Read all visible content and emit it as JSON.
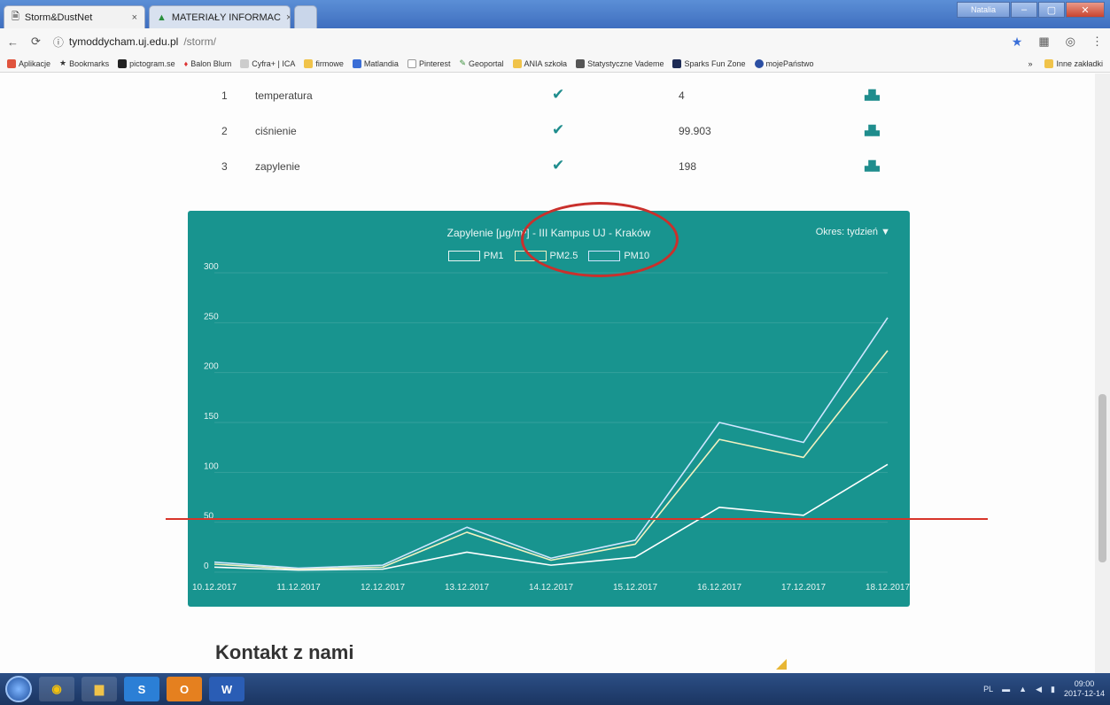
{
  "browser": {
    "tabs": [
      {
        "label": "Storm&DustNet",
        "active": true
      },
      {
        "label": "MATERIAŁY INFORMAC",
        "active": false
      }
    ],
    "window_text": "Natalia",
    "url_host": "tymoddycham.uj.edu.pl",
    "url_path": "/storm/",
    "bookmarks": [
      "Aplikacje",
      "Bookmarks",
      "pictogram.se",
      "Balon Blum",
      "Cyfra+ | ICA",
      "firmowe",
      "Matlandia",
      "Pinterest",
      "Geoportal",
      "ANIA szkoła",
      "Statystyczne Vademe",
      "Sparks Fun Zone",
      "mojePaństwo"
    ],
    "bookmarks_more": "»",
    "other_bookmarks": "Inne zakładki"
  },
  "sensors": [
    {
      "num": "1",
      "name": "temperatura",
      "value": "4"
    },
    {
      "num": "2",
      "name": "ciśnienie",
      "value": "99.903"
    },
    {
      "num": "3",
      "name": "zapylenie",
      "value": "198"
    }
  ],
  "chart": {
    "title": "Zapylenie [μg/m³] - III Kampus UJ - Kraków",
    "period": "Okres: tydzień"
  },
  "chart_data": {
    "type": "line",
    "title": "Zapylenie [μg/m³] - III Kampus UJ - Kraków",
    "xlabel": "",
    "ylabel": "",
    "categories": [
      "10.12.2017",
      "11.12.2017",
      "12.12.2017",
      "13.12.2017",
      "14.12.2017",
      "15.12.2017",
      "16.12.2017",
      "17.12.2017",
      "18.12.2017"
    ],
    "series": [
      {
        "name": "PM1",
        "color": "#ffffff",
        "values": [
          5,
          2,
          3,
          20,
          7,
          15,
          65,
          57,
          108
        ]
      },
      {
        "name": "PM2.5",
        "color": "#f1f1c0",
        "values": [
          8,
          3,
          5,
          40,
          12,
          28,
          133,
          115,
          222
        ]
      },
      {
        "name": "PM10",
        "color": "#cfe6ff",
        "values": [
          10,
          4,
          7,
          45,
          14,
          32,
          150,
          130,
          255
        ]
      }
    ],
    "yticks": [
      "0",
      "50",
      "100",
      "150",
      "200",
      "250",
      "300"
    ],
    "ylim": [
      0,
      300
    ],
    "grid": true,
    "legend": "top-center",
    "annotation": {
      "limit_value": 50,
      "limit_color": "#d8352a"
    }
  },
  "contact": {
    "heading": "Kontakt z nami"
  },
  "taskbar": {
    "apps": [
      "Chrome",
      "Explorer",
      "S",
      "Outlook",
      "W"
    ],
    "clock_time": "09:00",
    "clock_date": "2017-12-14"
  }
}
